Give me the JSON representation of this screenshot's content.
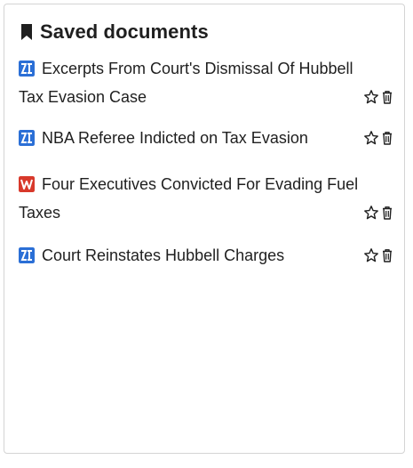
{
  "panel": {
    "title": "Saved documents"
  },
  "documents": [
    {
      "title_line1": "Excerpts From Court's Dismissal Of Hubbell",
      "title_line2": "Tax Evasion Case",
      "source_icon": "blue-news-logo-icon",
      "source_color": "#2b6fd6"
    },
    {
      "title": "NBA Referee Indicted on Tax Evasion",
      "source_icon": "blue-news-logo-icon",
      "source_color": "#2b6fd6"
    },
    {
      "title_line1": "Four Executives Convicted For Evading Fuel",
      "title_line2": "Taxes",
      "source_icon": "red-news-logo-icon",
      "source_color": "#d8392b"
    },
    {
      "title": "Court Reinstates Hubbell Charges",
      "source_icon": "blue-news-logo-icon",
      "source_color": "#2b6fd6"
    }
  ],
  "icons": {
    "star": "star-outline-icon",
    "delete": "trash-icon"
  }
}
